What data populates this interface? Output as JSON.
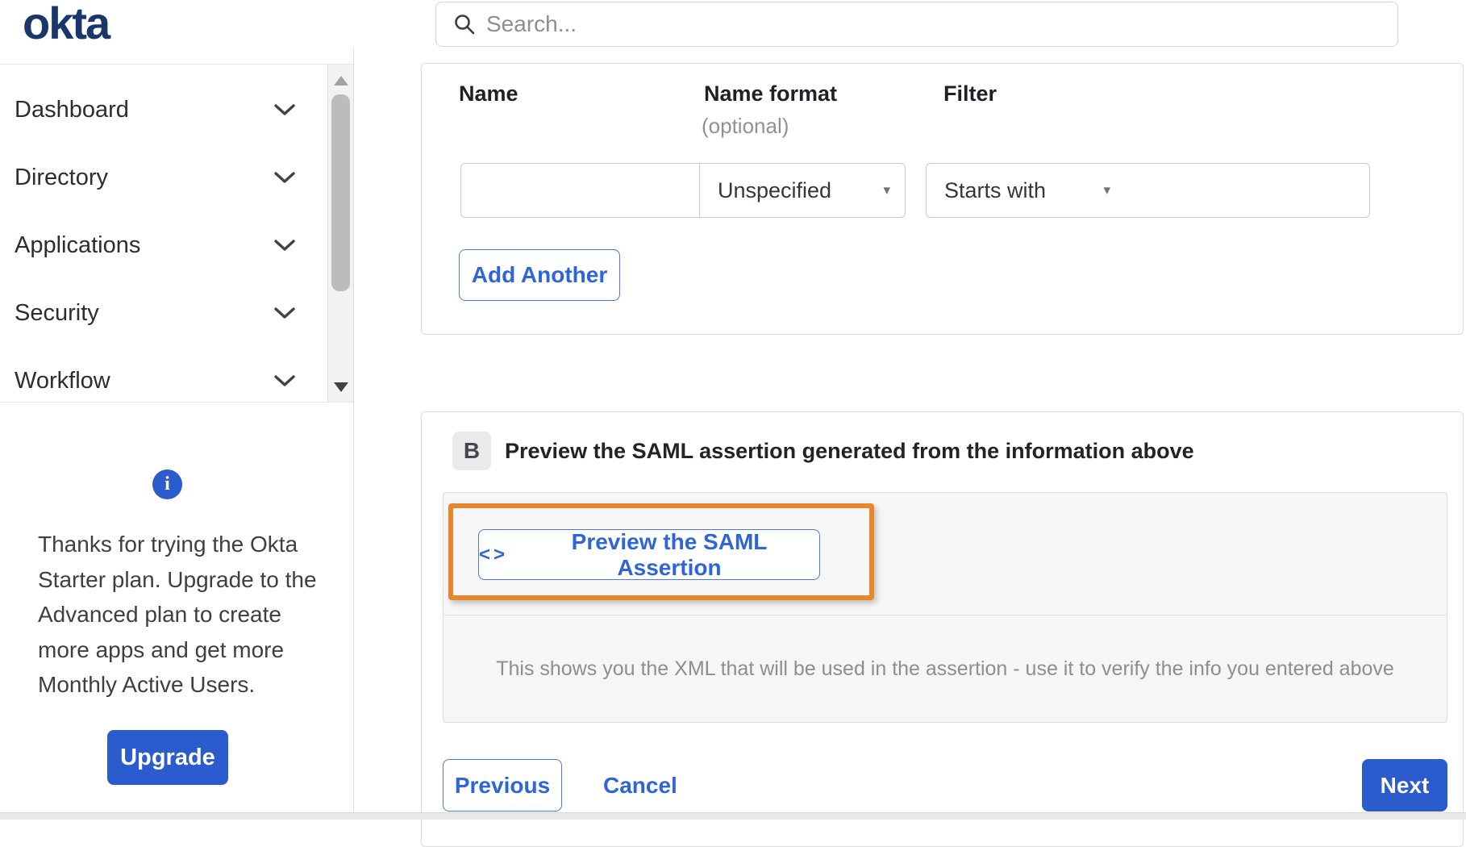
{
  "brand": {
    "logo_text": "okta"
  },
  "search": {
    "placeholder": "Search..."
  },
  "sidebar": {
    "items": [
      {
        "label": "Dashboard"
      },
      {
        "label": "Directory"
      },
      {
        "label": "Applications"
      },
      {
        "label": "Security"
      },
      {
        "label": "Workflow"
      }
    ],
    "upsell": {
      "text": "Thanks for trying the Okta Starter plan. Upgrade to the Advanced plan to create more apps and get more Monthly Active Users.",
      "button_label": "Upgrade"
    }
  },
  "form": {
    "columns": [
      {
        "label": "Name",
        "optional": ""
      },
      {
        "label": "Name format",
        "optional": "(optional)"
      },
      {
        "label": "Filter",
        "optional": ""
      }
    ],
    "name_value": "",
    "name_format_value": "Unspecified",
    "filter_op_value": "Starts with",
    "filter_value": "",
    "add_another_label": "Add Another"
  },
  "section_b": {
    "badge": "B",
    "title": "Preview the SAML assertion generated from the information above",
    "preview_button_label": "Preview the SAML Assertion",
    "description": "This shows you the XML that will be used in the assertion - use it to verify the info you entered above"
  },
  "footer": {
    "previous_label": "Previous",
    "cancel_label": "Cancel",
    "next_label": "Next"
  },
  "icons": {
    "code_glyph": "<>",
    "select_caret": "▾",
    "info_glyph": "i"
  },
  "colors": {
    "primary_blue": "#2b5cce",
    "link_blue": "#2e65d9",
    "brand_navy": "#19376b",
    "annotation_orange": "#e7872b"
  }
}
